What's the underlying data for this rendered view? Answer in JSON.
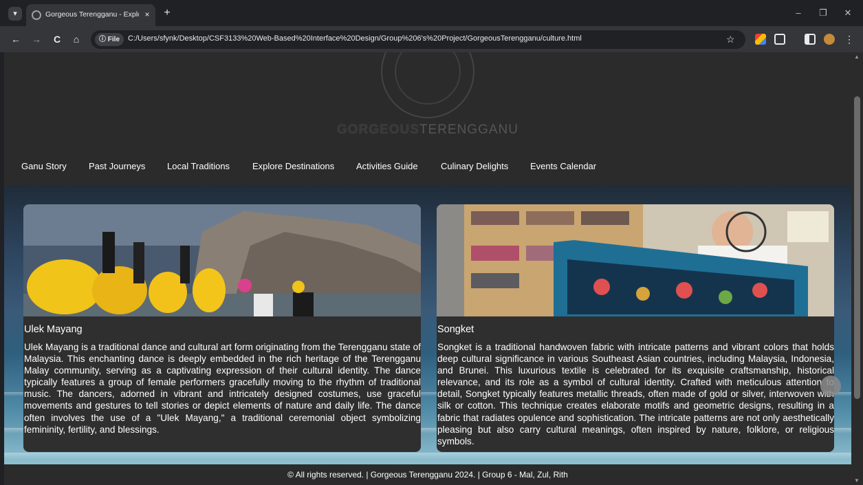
{
  "browser": {
    "tab_title": "Gorgeous Terengganu - Explore",
    "tab_close": "×",
    "new_tab": "+",
    "file_chip": "File",
    "url": "C:/Users/sfynk/Desktop/CSF3133%20Web-Based%20Interface%20Design/Group%206's%20Project/GorgeousTerengganu/culture.html",
    "back": "←",
    "forward": "→",
    "reload": "C",
    "home": "⌂",
    "bookmark": "☆",
    "minimize": "–",
    "restore": "❐",
    "close": "✕",
    "menu": "⋮"
  },
  "site": {
    "logo_word_1": "GORGEOUS",
    "logo_word_2": "TERENGGANU",
    "nav": [
      {
        "label": "Ganu Story"
      },
      {
        "label": "Past Journeys"
      },
      {
        "label": "Local Traditions"
      },
      {
        "label": "Explore Destinations"
      },
      {
        "label": "Activities Guide"
      },
      {
        "label": "Culinary Delights"
      },
      {
        "label": "Events Calendar"
      }
    ],
    "cards": [
      {
        "title": "Ulek Mayang",
        "body": "Ulek Mayang is a traditional dance and cultural art form originating from the Terengganu state of Malaysia. This enchanting dance is deeply embedded in the rich heritage of the Terengganu Malay community, serving as a captivating expression of their cultural identity. The dance typically features a group of female performers gracefully moving to the rhythm of traditional music. The dancers, adorned in vibrant and intricately designed costumes, use graceful movements and gestures to tell stories or depict elements of nature and daily life. The dance often involves the use of a \"Ulek Mayang,\" a traditional ceremonial object symbolizing femininity, fertility, and blessings."
      },
      {
        "title": "Songket",
        "body": "Songket is a traditional handwoven fabric with intricate patterns and vibrant colors that holds deep cultural significance in various Southeast Asian countries, including Malaysia, Indonesia, and Brunei. This luxurious textile is celebrated for its exquisite craftsmanship, historical relevance, and its role as a symbol of cultural identity. Crafted with meticulous attention to detail, Songket typically features metallic threads, often made of gold or silver, interwoven with silk or cotton. This technique creates elaborate motifs and geometric designs, resulting in a fabric that radiates opulence and sophistication. The intricate patterns are not only aesthetically pleasing but also carry cultural meanings, often inspired by nature, folklore, or religious symbols."
      }
    ],
    "footer": "© All rights reserved. | Gorgeous Terengganu 2024. | Group 6 - Mal, Zul, Rith"
  }
}
